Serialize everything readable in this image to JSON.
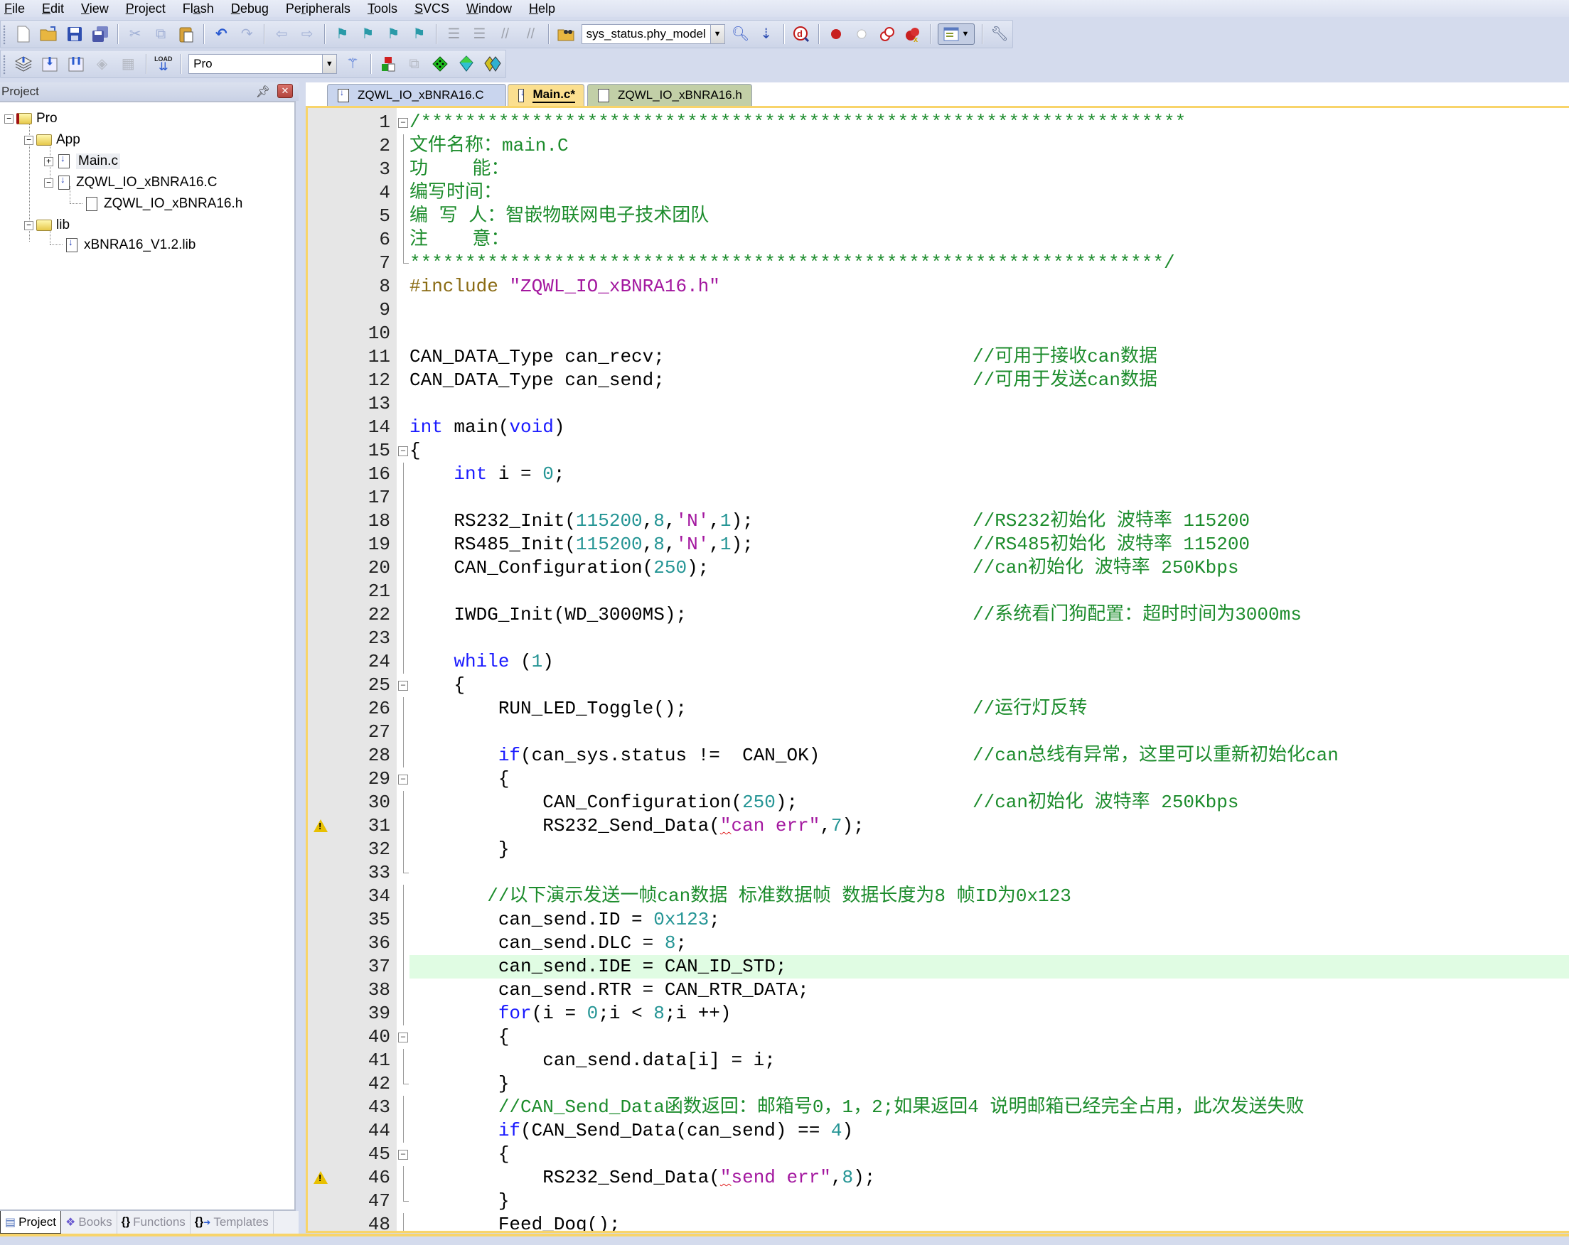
{
  "menu": {
    "items": [
      {
        "label": "File",
        "accel": "F"
      },
      {
        "label": "Edit",
        "accel": "E"
      },
      {
        "label": "View",
        "accel": "V"
      },
      {
        "label": "Project",
        "accel": "P"
      },
      {
        "label": "Flash",
        "accel": "a"
      },
      {
        "label": "Debug",
        "accel": "D"
      },
      {
        "label": "Peripherals",
        "accel": "r"
      },
      {
        "label": "Tools",
        "accel": "T"
      },
      {
        "label": "SVCS",
        "accel": "S"
      },
      {
        "label": "Window",
        "accel": "W"
      },
      {
        "label": "Help",
        "accel": "H"
      }
    ]
  },
  "toolbar1": {
    "find_combo_value": "sys_status.phy_model"
  },
  "toolbar2": {
    "target_combo_value": "Pro",
    "load_label": "LOAD"
  },
  "project_panel": {
    "title": "Project",
    "tree": {
      "root": "Pro",
      "groups": [
        {
          "name": "App",
          "files": [
            {
              "name": "Main.c",
              "expand": "+"
            },
            {
              "name": "ZQWL_IO_xBNRA16.C",
              "expand": "-",
              "children": [
                "ZQWL_IO_xBNRA16.h"
              ]
            }
          ]
        },
        {
          "name": "lib",
          "files": [
            {
              "name": "xBNRA16_V1.2.lib"
            }
          ]
        }
      ]
    },
    "bottom_tabs": [
      {
        "label": "Project",
        "active": true
      },
      {
        "label": "Books",
        "active": false
      },
      {
        "label": "Functions",
        "active": false
      },
      {
        "label": "Templates",
        "active": false
      }
    ]
  },
  "editor": {
    "tabs": [
      {
        "label": "ZQWL_IO_xBNRA16.C",
        "active": false
      },
      {
        "label": "Main.c*",
        "active": true
      },
      {
        "label": "ZQWL_IO_xBNRA16.h",
        "active": false
      }
    ],
    "highlighted_line": 37,
    "warning_lines": [
      31,
      46
    ],
    "lines": [
      {
        "n": "1",
        "code": "/*********************************************************************",
        "cls": "c-comment",
        "fold": "box"
      },
      {
        "n": "2",
        "code": "文件名称：main.C",
        "cls": "c-comment",
        "fold": "line"
      },
      {
        "n": "3",
        "code": "功    能：",
        "cls": "c-comment",
        "fold": "line"
      },
      {
        "n": "4",
        "code": "编写时间：",
        "cls": "c-comment",
        "fold": "line"
      },
      {
        "n": "5",
        "code": "编 写 人：智嵌物联网电子技术团队",
        "cls": "c-comment",
        "fold": "line"
      },
      {
        "n": "6",
        "code": "注    意：",
        "cls": "c-comment",
        "fold": "line"
      },
      {
        "n": "7",
        "code": "********************************************************************/",
        "cls": "c-comment",
        "fold": "end"
      },
      {
        "n": "8",
        "pre": "#include ",
        "str": "\"ZQWL_IO_xBNRA16.h\""
      },
      {
        "n": "9",
        "code": ""
      },
      {
        "n": "10",
        "code": ""
      },
      {
        "n": "11",
        "code": "CAN_DATA_Type can_recv;",
        "comment": "//可用于接收can数据"
      },
      {
        "n": "12",
        "code": "CAN_DATA_Type can_send;",
        "comment": "//可用于发送can数据"
      },
      {
        "n": "13",
        "code": ""
      },
      {
        "n": "14",
        "kw": "int",
        "code": " main(",
        "kw2": "void",
        "code2": ")"
      },
      {
        "n": "15",
        "code": "{",
        "fold": "box"
      },
      {
        "n": "16",
        "indent": "    ",
        "kw": "int",
        "code": " i = ",
        "num": "0",
        "code2": ";",
        "fold": "line"
      },
      {
        "n": "17",
        "code": "",
        "fold": "line"
      },
      {
        "n": "18",
        "code": "    RS232_Init(",
        "num": "115200",
        "code2": ",",
        "num2": "8",
        "code3": ",",
        "str": "'N'",
        "code4": ",",
        "num3": "1",
        "code5": ");",
        "comment": "//RS232初始化 波特率 115200",
        "fold": "line"
      },
      {
        "n": "19",
        "code": "    RS485_Init(",
        "num": "115200",
        "code2": ",",
        "num2": "8",
        "code3": ",",
        "str": "'N'",
        "code4": ",",
        "num3": "1",
        "code5": ");",
        "comment": "//RS485初始化 波特率 115200",
        "fold": "line"
      },
      {
        "n": "20",
        "code": "    CAN_Configuration(",
        "num": "250",
        "code2": ");",
        "comment": "//can初始化 波特率 250Kbps",
        "fold": "line"
      },
      {
        "n": "21",
        "code": "",
        "fold": "line"
      },
      {
        "n": "22",
        "code": "    IWDG_Init(WD_3000MS);",
        "comment": "//系统看门狗配置：超时时间为3000ms",
        "fold": "line"
      },
      {
        "n": "23",
        "code": "",
        "fold": "line"
      },
      {
        "n": "24",
        "indent": "    ",
        "kw": "while",
        "code": " (",
        "num": "1",
        "code2": ")",
        "fold": "line"
      },
      {
        "n": "25",
        "code": "    {",
        "fold": "box"
      },
      {
        "n": "26",
        "code": "        RUN_LED_Toggle();",
        "comment": "//运行灯反转",
        "fold": "line"
      },
      {
        "n": "27",
        "code": "",
        "fold": "line"
      },
      {
        "n": "28",
        "indent": "        ",
        "kw": "if",
        "code": "(can_sys.status !=  CAN_OK)",
        "comment": "//can总线有异常，这里可以重新初始化can",
        "fold": "line"
      },
      {
        "n": "29",
        "code": "        {",
        "fold": "box"
      },
      {
        "n": "30",
        "code": "            CAN_Configuration(",
        "num": "250",
        "code2": ");",
        "comment": "//can初始化 波特率 250Kbps",
        "fold": "line"
      },
      {
        "n": "31",
        "code": "            RS232_Send_Data(",
        "str": "\"can err\"",
        "code2": ",",
        "num": "7",
        "code3": ");",
        "fold": "line",
        "squig": true
      },
      {
        "n": "32",
        "code": "        }",
        "fold": "line"
      },
      {
        "n": "33",
        "code": "",
        "fold": "end"
      },
      {
        "n": "34",
        "code": "       //以下演示发送一帧can数据 标准数据帧 数据长度为8 帧ID为0x123",
        "cls": "c-comment",
        "fold": "line"
      },
      {
        "n": "35",
        "code": "        can_send.ID = ",
        "num": "0x123",
        "code2": ";",
        "fold": "line"
      },
      {
        "n": "36",
        "code": "        can_send.DLC = ",
        "num": "8",
        "code2": ";",
        "fold": "line"
      },
      {
        "n": "37",
        "code": "        can_send.IDE = CAN_ID_STD;",
        "fold": "line"
      },
      {
        "n": "38",
        "code": "        can_send.RTR = CAN_RTR_DATA;",
        "fold": "line"
      },
      {
        "n": "39",
        "indent": "        ",
        "kw": "for",
        "code": "(i = ",
        "num": "0",
        "code2": ";i < ",
        "num2": "8",
        "code3": ";i ++)",
        "fold": "line"
      },
      {
        "n": "40",
        "code": "        {",
        "fold": "box"
      },
      {
        "n": "41",
        "code": "            can_send.data[i] = i;",
        "fold": "line"
      },
      {
        "n": "42",
        "code": "        }",
        "fold": "end"
      },
      {
        "n": "43",
        "code": "        //CAN_Send_Data函数返回：邮箱号0，1，2;如果返回4 说明邮箱已经完全占用，此次发送失败",
        "cls": "c-comment",
        "fold": "line"
      },
      {
        "n": "44",
        "indent": "        ",
        "kw": "if",
        "code": "(CAN_Send_Data(can_send) == ",
        "num": "4",
        "code2": ")",
        "fold": "line"
      },
      {
        "n": "45",
        "code": "        {",
        "fold": "box"
      },
      {
        "n": "46",
        "code": "            RS232_Send_Data(",
        "str": "\"send err\"",
        "code2": ",",
        "num": "8",
        "code3": ");",
        "fold": "line",
        "squig": true
      },
      {
        "n": "47",
        "code": "        }",
        "fold": "end"
      },
      {
        "n": "48",
        "code": "        Feed_Dog();",
        "fold": "line"
      }
    ]
  }
}
